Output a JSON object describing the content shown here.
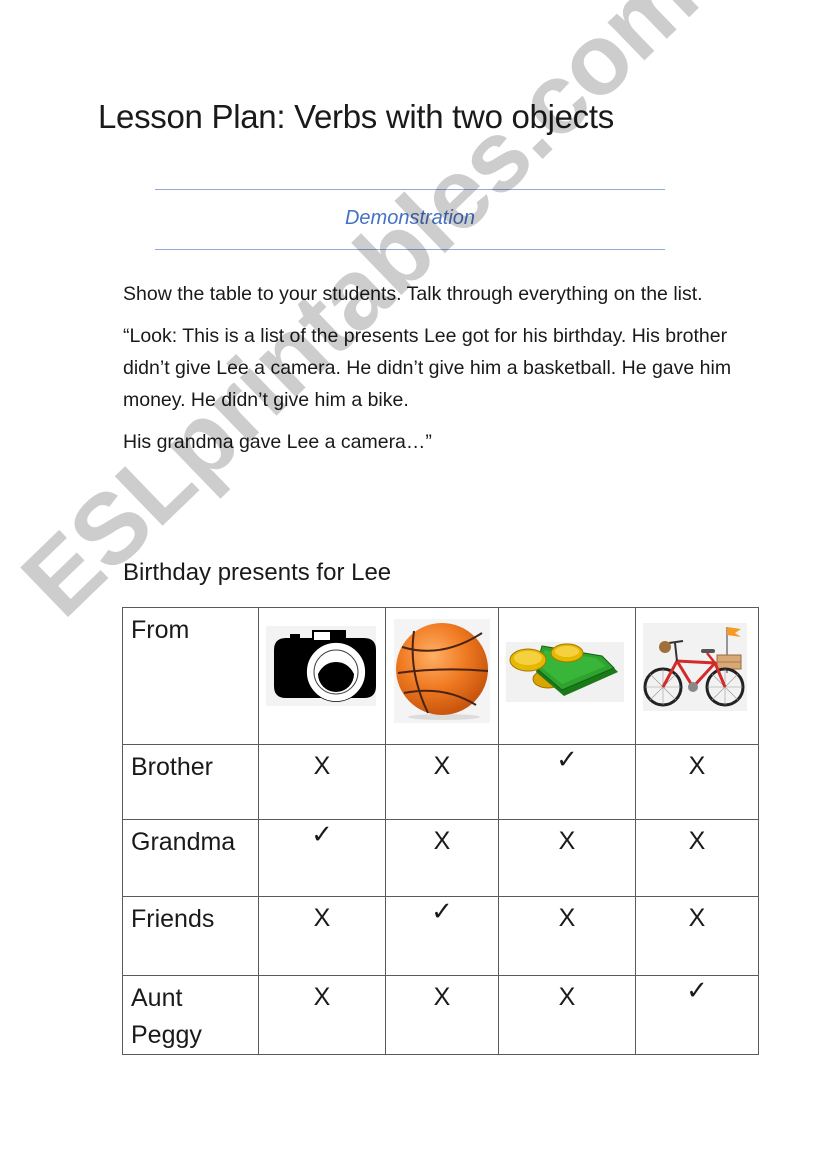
{
  "document": {
    "title": "Lesson Plan: Verbs with two objects",
    "section_heading": "Demonstration",
    "paragraphs": [
      "Show the table to your students. Talk through everything on the list.",
      "“Look: This is a list of the presents Lee got for his birthday. His brother didn’t give Lee a camera. He didn’t give him a basketball. He gave him money. He didn’t give him a bike.",
      "His grandma gave Lee a camera…”"
    ],
    "colors": {
      "heading_accent": "#4472c4",
      "rule": "#8eaadb",
      "watermark": "#c4c4c4"
    }
  },
  "table": {
    "caption": "Birthday presents for Lee",
    "header": {
      "first_col_label": "From",
      "presents": [
        {
          "name": "camera",
          "icon": "camera-icon"
        },
        {
          "name": "basketball",
          "icon": "basketball-icon"
        },
        {
          "name": "money",
          "icon": "money-icon"
        },
        {
          "name": "bike",
          "icon": "bike-icon"
        }
      ]
    },
    "rows": [
      {
        "from": "Brother",
        "marks": [
          "X",
          "✓",
          "X"
        ],
        "cells": [
          "X",
          "X",
          "✓",
          "X"
        ]
      },
      {
        "from": "Grandma",
        "cells": [
          "✓",
          "X",
          "X",
          "X"
        ]
      },
      {
        "from": "Friends",
        "cells": [
          "X",
          "✓",
          "X",
          "X"
        ]
      },
      {
        "from": "Aunt Peggy",
        "cells": [
          "X",
          "X",
          "X",
          "✓"
        ]
      }
    ],
    "legend": {
      "given": "✓",
      "not_given": "X"
    }
  },
  "watermark": {
    "text": "ESLprintables.com"
  }
}
